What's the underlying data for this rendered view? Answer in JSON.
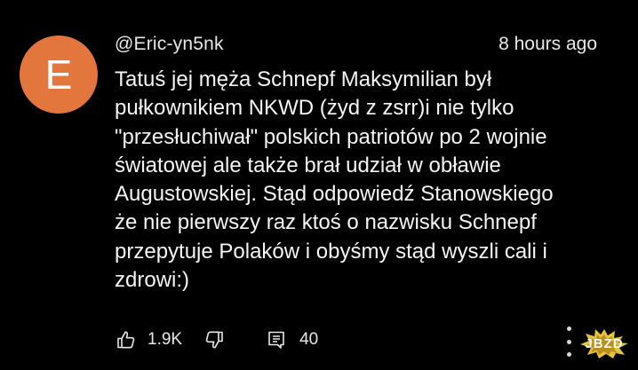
{
  "comment": {
    "avatar_letter": "E",
    "avatar_color": "#e2763d",
    "username": "@Eric-yn5nk",
    "timestamp": "8 hours ago",
    "text": "Tatuś jej męża Schnepf Maksymilian był\npułkownikiem NKWD (żyd  z zsrr)i nie tylko\n\"przesłuchiwał\" polskich patriotów po 2 wojnie\nświatowej ale także brał udział w obławie\nAugustowskiej. Stąd odpowiedź Stanowskiego\nże nie pierwszy raz ktoś o nazwisku Schnepf\nprzepytuje Polaków i obyśmy stąd wyszli cali i\nzdrowi:)"
  },
  "actions": {
    "like_icon": "thumbs-up-icon",
    "like_count": "1.9K",
    "dislike_icon": "thumbs-down-icon",
    "reply_icon": "reply-icon",
    "reply_count": "40",
    "more_icon": "more-vertical-icon"
  },
  "watermark": {
    "text": "JBZD"
  },
  "colors": {
    "background": "#000000",
    "text": "#f1f1f1",
    "watermark": "#e6c33a"
  }
}
